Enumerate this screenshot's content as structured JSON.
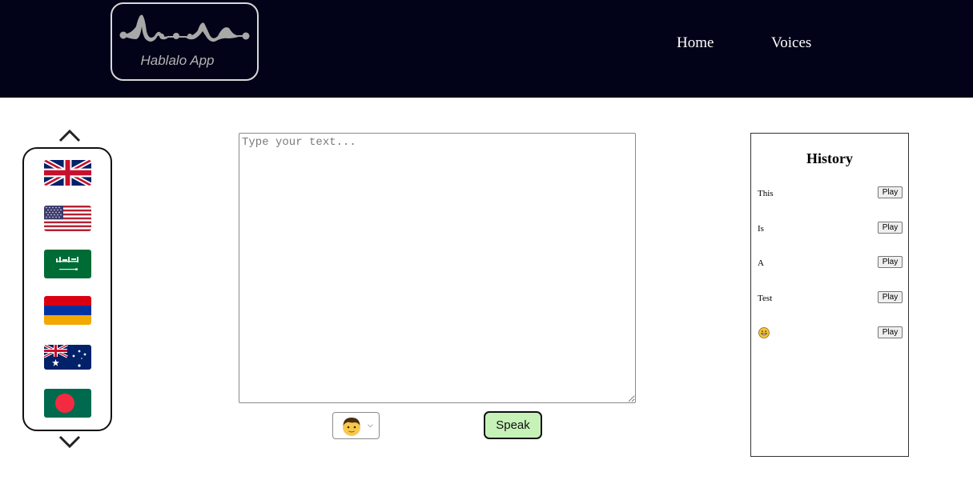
{
  "header": {
    "logo_text": "Hablalo App",
    "nav": [
      {
        "label": "Home"
      },
      {
        "label": "Voices"
      }
    ],
    "background": "#020218"
  },
  "languages": {
    "up_icon": "chevron-up-icon",
    "down_icon": "chevron-down-icon",
    "flags": [
      {
        "name": "uk-flag-icon"
      },
      {
        "name": "us-flag-icon"
      },
      {
        "name": "saudi-arabia-flag-icon"
      },
      {
        "name": "armenia-flag-icon"
      },
      {
        "name": "australia-flag-icon"
      },
      {
        "name": "bangladesh-flag-icon"
      }
    ]
  },
  "editor": {
    "placeholder": "Type your text...",
    "value": ""
  },
  "controls": {
    "voice_icon": "boy-face-icon",
    "speak_label": "Speak",
    "speak_color": "#c6f2b8"
  },
  "history": {
    "title": "History",
    "items": [
      {
        "text": "This",
        "play": "Play"
      },
      {
        "text": "Is",
        "play": "Play"
      },
      {
        "text": "A",
        "play": "Play"
      },
      {
        "text": "Test",
        "play": "Play"
      },
      {
        "text": "",
        "icon": "grinning-face-icon",
        "play": "Play"
      }
    ]
  }
}
